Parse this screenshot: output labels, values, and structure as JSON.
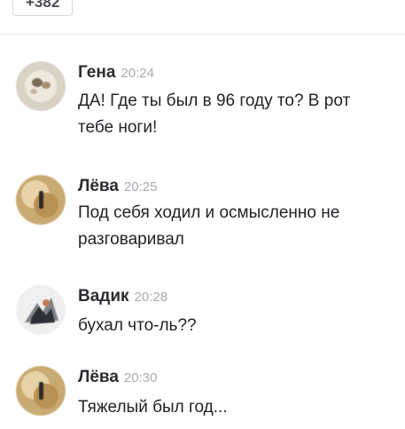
{
  "header": {
    "more_label": "+382"
  },
  "messages": [
    {
      "author": "Гена",
      "time": "20:24",
      "text": "ДА! Где ты был в 96 году то? В рот тебе ноги!"
    },
    {
      "author": "Лёва",
      "time": "20:25",
      "text": "Под себя ходил и осмысленно не разговаривал"
    },
    {
      "author": "Вадик",
      "time": "20:28",
      "text": "бухал что-ль??"
    },
    {
      "author": "Лёва",
      "time": "20:30",
      "text": "Тяжелый был год..."
    }
  ],
  "colors": {
    "background": "#ffffff",
    "author_text": "#2a2c30",
    "time_text": "#a7abb2",
    "message_text": "#1f2226",
    "divider": "#e3e4e8"
  },
  "icons": {
    "avatar_1": "cat-avatar",
    "avatar_2": "candle-avatar",
    "avatar_3": "animal-avatar",
    "avatar_4": "candle-avatar"
  }
}
